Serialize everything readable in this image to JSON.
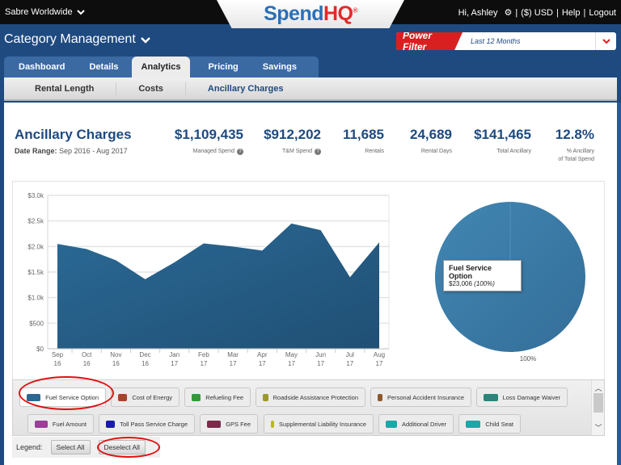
{
  "topbar": {
    "org": "Sabre Worldwide",
    "greeting": "Hi, Ashley",
    "currency": "($) USD",
    "help": "Help",
    "logout": "Logout",
    "sep": "|"
  },
  "logo": {
    "part1": "Spend",
    "part2": "HQ",
    "reg": "®"
  },
  "header": {
    "module": "Category Management",
    "power_filter_label": "Power Filter",
    "power_filter_value": "Last 12 Months"
  },
  "tabs": [
    {
      "label": "Dashboard"
    },
    {
      "label": "Details"
    },
    {
      "label": "Analytics",
      "active": true
    },
    {
      "label": "Pricing"
    },
    {
      "label": "Savings"
    }
  ],
  "subtabs": [
    {
      "label": "Rental Length"
    },
    {
      "label": "Costs"
    },
    {
      "label": "Ancillary Charges",
      "active": true
    }
  ],
  "summary": {
    "title": "Ancillary Charges",
    "date_range_label": "Date Range:",
    "date_range_value": "Sep 2016 - Aug 2017",
    "kpis": [
      {
        "value": "$1,109,435",
        "label": "Managed Spend",
        "help": true
      },
      {
        "value": "$912,202",
        "label": "T&M Spend",
        "help": true
      },
      {
        "value": "11,685",
        "label": "Rentals"
      },
      {
        "value": "24,689",
        "label": "Rental Days"
      },
      {
        "value": "$141,465",
        "label": "Total Ancillary"
      },
      {
        "value": "12.8%",
        "label": "% Ancillary",
        "label2": "of Total Spend"
      }
    ]
  },
  "chart_data": [
    {
      "type": "area",
      "title": "",
      "xlabel": "",
      "ylabel": "",
      "categories": [
        "Sep 16",
        "Oct 16",
        "Nov 16",
        "Dec 16",
        "Jan 17",
        "Feb 17",
        "Mar 17",
        "Apr 17",
        "May 17",
        "Jun 17",
        "Jul 17",
        "Aug 17"
      ],
      "x_tick_labels": [
        [
          "Sep",
          "16"
        ],
        [
          "Oct",
          "16"
        ],
        [
          "Nov",
          "16"
        ],
        [
          "Dec",
          "16"
        ],
        [
          "Jan",
          "17"
        ],
        [
          "Feb",
          "17"
        ],
        [
          "Mar",
          "17"
        ],
        [
          "Apr",
          "17"
        ],
        [
          "May",
          "17"
        ],
        [
          "Jun",
          "17"
        ],
        [
          "Jul",
          "17"
        ],
        [
          "Aug",
          "17"
        ]
      ],
      "series": [
        {
          "name": "Fuel Service Option",
          "color": "#25618c",
          "values": [
            2050,
            1950,
            1730,
            1360,
            1690,
            2060,
            2000,
            1920,
            2450,
            2320,
            1400,
            2080
          ]
        }
      ],
      "ylim": [
        0,
        3000
      ],
      "yticks": [
        0,
        500,
        1000,
        1500,
        2000,
        2500,
        3000
      ],
      "ytick_labels": [
        "$0",
        "$500",
        "$1.0k",
        "$1.5k",
        "$2.0k",
        "$2.5k",
        "$3.0k"
      ],
      "grid": true
    },
    {
      "type": "pie",
      "slices": [
        {
          "label": "Fuel Service Option",
          "value": 23006,
          "percent": 100,
          "color": "#3a7aa6"
        }
      ],
      "data_label": "100%",
      "tooltip": {
        "name": "Fuel Service Option",
        "amount": "$23,006",
        "percent": "(100%)"
      }
    }
  ],
  "legend": {
    "items": [
      {
        "label": "Fuel Service Option",
        "color": "#2d6892",
        "selected": true
      },
      {
        "label": "Cost of Energy",
        "color": "#a8432a"
      },
      {
        "label": "Refueling Fee",
        "color": "#2f9a3a"
      },
      {
        "label": "Roadside Assistance Protection",
        "color": "#9a9a2a"
      },
      {
        "label": "Personal Accident Insurance",
        "color": "#8b5a2b"
      },
      {
        "label": "Loss Damage Waiver",
        "color": "#2a857a"
      },
      {
        "label": "Fuel Amount",
        "color": "#9a3f9a"
      },
      {
        "label": "Toll Pass Service Charge",
        "color": "#1a1ab0"
      },
      {
        "label": "GPS Fee",
        "color": "#7a2a4a"
      },
      {
        "label": "Supplemental Liability Insurance",
        "color": "#b8b818"
      },
      {
        "label": "Additional Driver",
        "color": "#1aa8a8"
      },
      {
        "label": "Child Seat",
        "color": "#1aa8a8"
      }
    ],
    "label": "Legend:",
    "select_all": "Select All",
    "deselect_all": "Deselect All"
  }
}
